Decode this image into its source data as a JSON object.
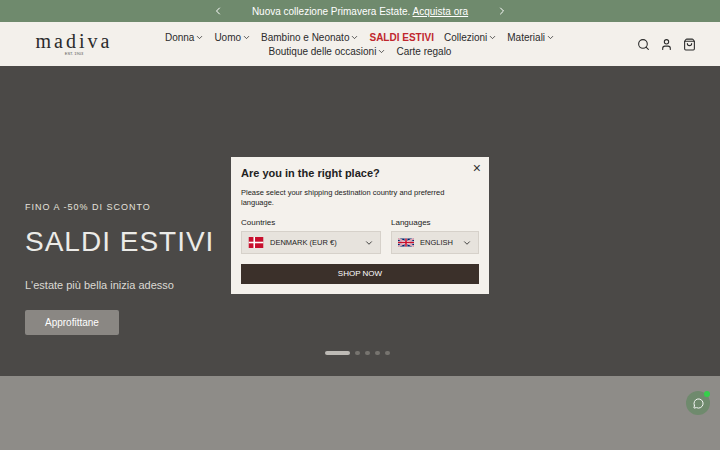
{
  "announcement": {
    "text": "Nuova collezione Primavera Estate.",
    "link": "Acquista ora"
  },
  "logo": {
    "name": "madiva",
    "tagline": "EST. 1903"
  },
  "nav": [
    {
      "label": "Donna",
      "dropdown": true,
      "highlight": false
    },
    {
      "label": "Uomo",
      "dropdown": true,
      "highlight": false
    },
    {
      "label": "Bambino e Neonato",
      "dropdown": true,
      "highlight": false
    },
    {
      "label": "SALDI ESTIVI",
      "dropdown": false,
      "highlight": true
    },
    {
      "label": "Collezioni",
      "dropdown": true,
      "highlight": false
    },
    {
      "label": "Materiali",
      "dropdown": true,
      "highlight": false
    },
    {
      "label": "Boutique delle occasioni",
      "dropdown": true,
      "highlight": false
    },
    {
      "label": "Carte regalo",
      "dropdown": false,
      "highlight": false
    }
  ],
  "hero": {
    "eyebrow": "FINO A -50% DI SCONTO",
    "title": "SALDI ESTIVI",
    "subtitle": "L'estate più bella inizia adesso",
    "button": "Approfittane",
    "slides": [
      {
        "selected": true
      },
      {
        "selected": false
      },
      {
        "selected": false
      },
      {
        "selected": false
      },
      {
        "selected": false
      }
    ]
  },
  "modal": {
    "title": "Are you in the right place?",
    "description": "Please select your shipping destination country and preferred language.",
    "countries_label": "Countries",
    "country": "DENMARK (EUR €)",
    "languages_label": "Languages",
    "language": "ENGLISH",
    "button": "SHOP NOW",
    "close": "×"
  },
  "chat": {
    "online": true
  }
}
